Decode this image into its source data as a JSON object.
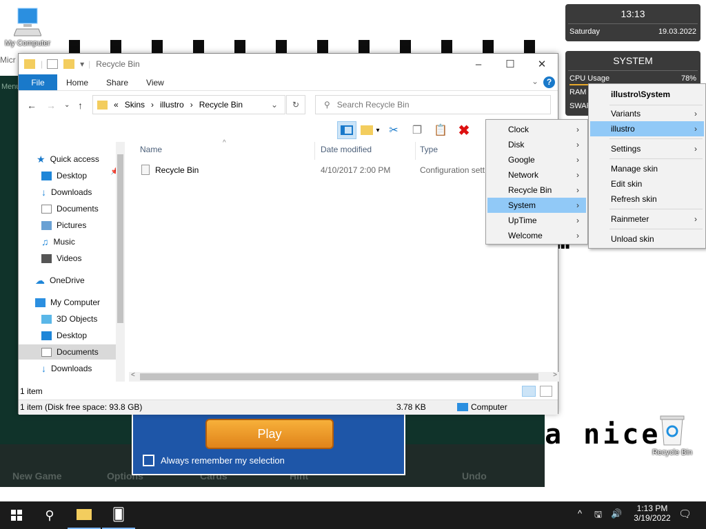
{
  "desktop": {
    "icons": {
      "my_computer": "My Computer",
      "recycle_bin": "Recycle Bin"
    },
    "bg_text_partial": "a nice",
    "bg_text_menu": "Menu",
    "bg_text_mic": "Micr"
  },
  "game": {
    "play_label": "Play",
    "remember_label": "Always remember my selection",
    "bar": {
      "new_game": "New Game",
      "options": "Options",
      "cards": "Cards",
      "hint": "Hint",
      "undo": "Undo"
    }
  },
  "explorer": {
    "title": "Recycle Bin",
    "tabs": [
      "File",
      "Home",
      "Share",
      "View"
    ],
    "breadcrumb": [
      "«",
      "Skins",
      "illustro",
      "Recycle Bin"
    ],
    "search_placeholder": "Search Recycle Bin",
    "nav": {
      "quick_access": "Quick access",
      "desktop": "Desktop",
      "downloads": "Downloads",
      "documents": "Documents",
      "pictures": "Pictures",
      "music": "Music",
      "videos": "Videos",
      "onedrive": "OneDrive",
      "my_computer": "My Computer",
      "objects3d": "3D Objects",
      "desktop2": "Desktop",
      "documents2": "Documents",
      "downloads2": "Downloads"
    },
    "columns": {
      "name": "Name",
      "date": "Date modified",
      "type": "Type"
    },
    "rows": [
      {
        "name": "Recycle Bin",
        "date": "4/10/2017 2:00 PM",
        "type": "Configuration sett"
      }
    ],
    "status_items": "1 item",
    "status_disk": "1 item (Disk free space: 93.8 GB)",
    "status_size": "3.78 KB",
    "status_location": "Computer"
  },
  "clock_widget": {
    "time": "13:13",
    "day": "Saturday",
    "date": "19.03.2022"
  },
  "system_widget": {
    "title": "SYSTEM",
    "cpu_label": "CPU Usage",
    "cpu_value": "78%",
    "cpu_level": 0.78,
    "ram_label": "RAM",
    "swap_label": "SWAP"
  },
  "context_menu": {
    "header": "illustro\\System",
    "items": [
      "Variants",
      "illustro",
      "Settings",
      "Manage skin",
      "Edit skin",
      "Refresh skin",
      "Rainmeter",
      "Unload skin"
    ]
  },
  "submenu": {
    "items": [
      "Clock",
      "Disk",
      "Google",
      "Network",
      "Recycle Bin",
      "System",
      "UpTime",
      "Welcome"
    ]
  },
  "taskbar": {
    "time": "1:13 PM",
    "date": "3/19/2022"
  },
  "colors": {
    "accent": "#1979ca",
    "menu_highlight": "#91c9f7",
    "widget_bg": "#3a3a3a",
    "taskbar": "#1b1b1b"
  }
}
